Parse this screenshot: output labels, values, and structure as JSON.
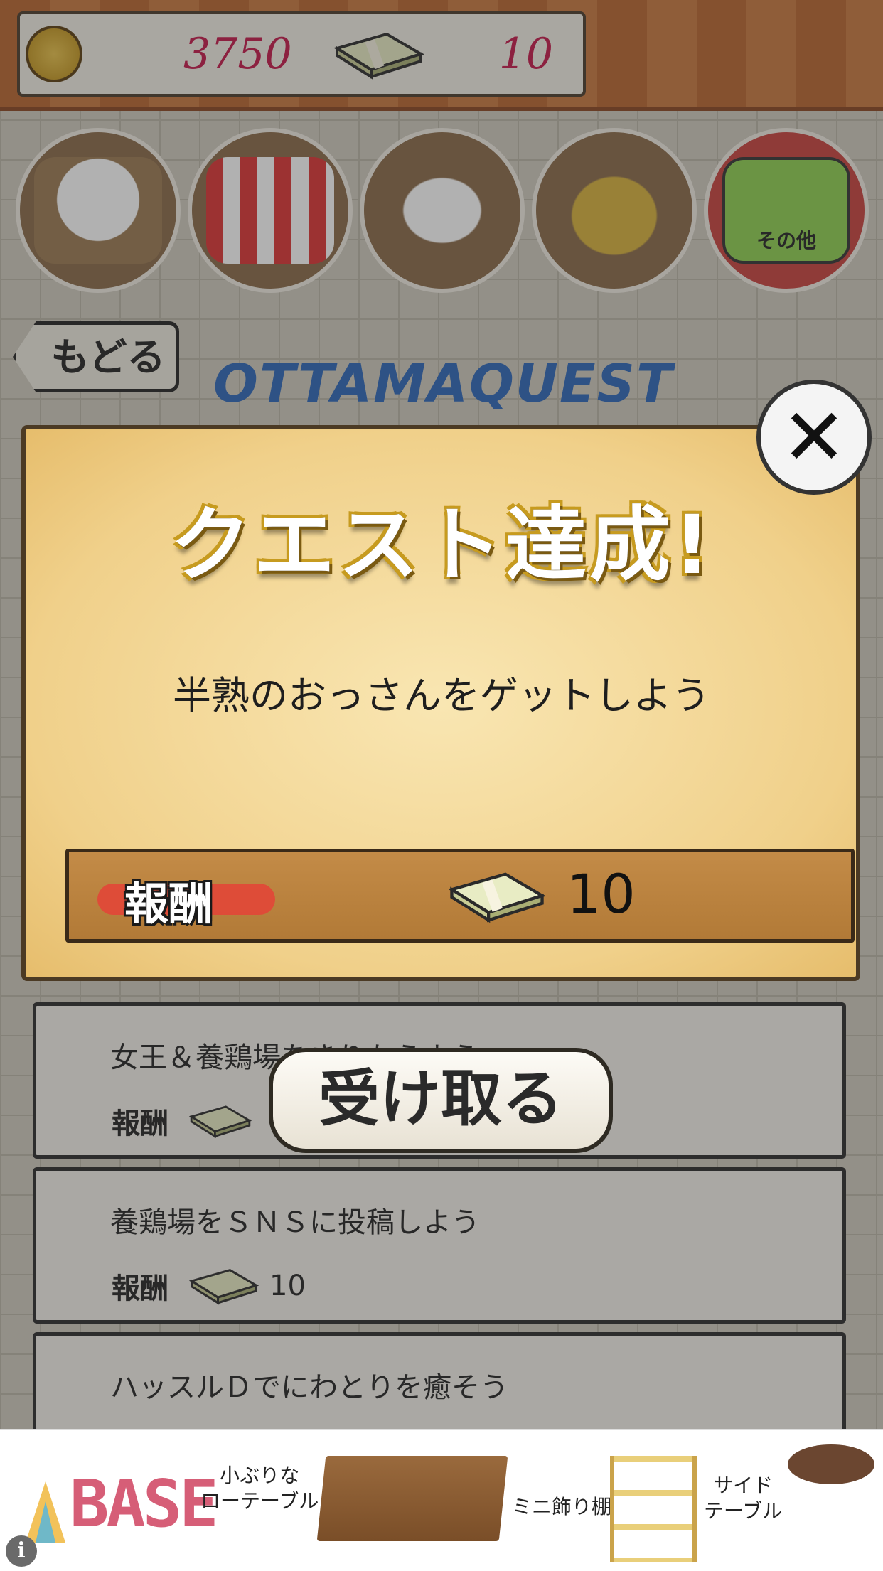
{
  "header": {
    "coin_value": "3750",
    "money_value": "10",
    "colors": {
      "value_text": "#c4174a"
    }
  },
  "menu": [
    {
      "name": "chicken-nest"
    },
    {
      "name": "shop"
    },
    {
      "name": "egg"
    },
    {
      "name": "pot"
    },
    {
      "name": "other",
      "label": "その他"
    }
  ],
  "back_label": "もどる",
  "logo_text": "OTTAMAQUEST",
  "dialog": {
    "title": "クエスト達成!",
    "quest_text": "半熟のおっさんをゲットしよう",
    "reward_label": "報酬",
    "reward_value": "10",
    "close_icon": "close-icon"
  },
  "receive_label": "受け取る",
  "quests": [
    {
      "title": "女王＆養鶏場をきりたうよう",
      "reward_label": "報酬",
      "reward_value": ""
    },
    {
      "title": "養鶏場をＳＮＳに投稿しよう",
      "reward_label": "報酬",
      "reward_value": "10"
    },
    {
      "title": "ハッスルＤでにわとりを癒そう",
      "reward_label": "",
      "reward_value": ""
    }
  ],
  "ad": {
    "logo": "BASE",
    "captions": [
      "小ぶりな\nローテーブル",
      "ミニ飾り棚",
      "サイド\nテーブル"
    ],
    "info_icon": "i"
  }
}
